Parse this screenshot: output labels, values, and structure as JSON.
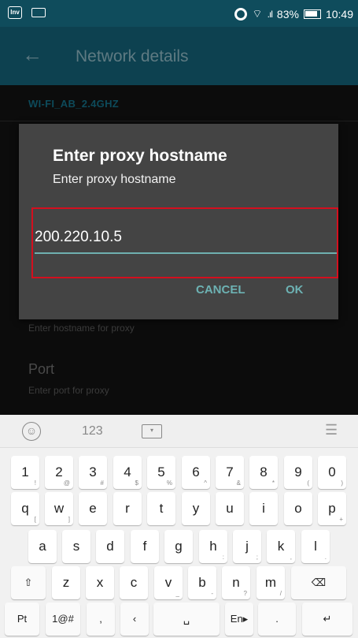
{
  "status_bar": {
    "left_icon_label": "Inv",
    "battery_text": "83%",
    "time": "10:49"
  },
  "app_bar": {
    "title": "Network details"
  },
  "background": {
    "ssid": "WI-FI_AB_2.4GHZ",
    "hostname_hint": "Enter hostname for proxy",
    "port_label": "Port",
    "port_hint": "Enter port for proxy"
  },
  "dialog": {
    "title": "Enter proxy hostname",
    "subtitle": "Enter proxy hostname",
    "input_value": "200.220.10.5",
    "cancel_label": "CANCEL",
    "ok_label": "OK",
    "highlight_color": "#d40f1e",
    "accent_color": "#6db2b3"
  },
  "keyboard": {
    "toolbar": {
      "emoji_icon": "smiley-icon",
      "numbers_label": "123",
      "keyboard_icon": "keyboard-hide-icon",
      "menu_icon": "menu-icon"
    },
    "rows": [
      [
        {
          "main": "1",
          "sub": "!"
        },
        {
          "main": "2",
          "sub": "@"
        },
        {
          "main": "3",
          "sub": "#"
        },
        {
          "main": "4",
          "sub": "$"
        },
        {
          "main": "5",
          "sub": "%"
        },
        {
          "main": "6",
          "sub": "^"
        },
        {
          "main": "7",
          "sub": "&"
        },
        {
          "main": "8",
          "sub": "*"
        },
        {
          "main": "9",
          "sub": "("
        },
        {
          "main": "0",
          "sub": ")"
        }
      ],
      [
        {
          "main": "q",
          "sub": "["
        },
        {
          "main": "w",
          "sub": "]"
        },
        {
          "main": "e",
          "sub": ""
        },
        {
          "main": "r",
          "sub": ""
        },
        {
          "main": "t",
          "sub": ""
        },
        {
          "main": "y",
          "sub": ""
        },
        {
          "main": "u",
          "sub": ""
        },
        {
          "main": "i",
          "sub": ""
        },
        {
          "main": "o",
          "sub": ""
        },
        {
          "main": "p",
          "sub": "+"
        }
      ],
      [
        {
          "main": "a",
          "sub": ""
        },
        {
          "main": "s",
          "sub": ""
        },
        {
          "main": "d",
          "sub": ""
        },
        {
          "main": "f",
          "sub": ""
        },
        {
          "main": "g",
          "sub": ""
        },
        {
          "main": "h",
          "sub": ":"
        },
        {
          "main": "j",
          "sub": ";"
        },
        {
          "main": "k",
          "sub": ","
        },
        {
          "main": "l",
          "sub": "."
        }
      ],
      [
        {
          "main": "⇧",
          "sub": ""
        },
        {
          "main": "z",
          "sub": ""
        },
        {
          "main": "x",
          "sub": ""
        },
        {
          "main": "c",
          "sub": ""
        },
        {
          "main": "v",
          "sub": "_"
        },
        {
          "main": "b",
          "sub": "-"
        },
        {
          "main": "n",
          "sub": "?"
        },
        {
          "main": "m",
          "sub": "/"
        },
        {
          "main": "⌫",
          "sub": ""
        }
      ],
      [
        {
          "main": "Pt",
          "sub": ""
        },
        {
          "main": "1@#",
          "sub": ""
        },
        {
          "main": ",",
          "sub": ""
        },
        {
          "main": "‹",
          "sub": ""
        },
        {
          "main": "␣",
          "sub": ""
        },
        {
          "main": "En▸",
          "sub": ""
        },
        {
          "main": ".",
          "sub": ""
        },
        {
          "main": "↵",
          "sub": ""
        }
      ]
    ]
  }
}
